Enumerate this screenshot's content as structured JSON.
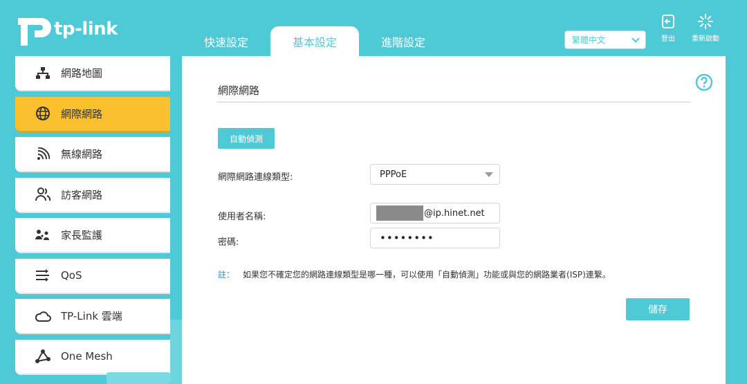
{
  "brand": {
    "logo_text": "tp-link"
  },
  "header": {
    "tabs": [
      {
        "label": "快速設定",
        "active": false
      },
      {
        "label": "基本設定",
        "active": true
      },
      {
        "label": "進階設定",
        "active": false
      }
    ],
    "language": {
      "selected": "繁體中文"
    },
    "logout_label": "登出",
    "reboot_label": "重新啟動"
  },
  "sidebar": {
    "items": [
      {
        "label": "網路地圖",
        "icon": "network-map-icon",
        "active": false
      },
      {
        "label": "網際網路",
        "icon": "globe-icon",
        "active": true
      },
      {
        "label": "無線網路",
        "icon": "wireless-icon",
        "active": false
      },
      {
        "label": "訪客網路",
        "icon": "guest-users-icon",
        "active": false
      },
      {
        "label": "家長監護",
        "icon": "parental-control-icon",
        "active": false
      },
      {
        "label": "QoS",
        "icon": "qos-icon",
        "active": false
      },
      {
        "label": "TP-Link 雲端",
        "icon": "cloud-icon",
        "active": false
      },
      {
        "label": "One Mesh",
        "icon": "mesh-icon",
        "active": false
      }
    ]
  },
  "main": {
    "title": "網際網路",
    "auto_detect_label": "自動偵測",
    "connection_type": {
      "label": "網際網路連線類型:",
      "value": "PPPoE"
    },
    "username": {
      "label": "使用者名稱:",
      "value": "@ip.hinet.net"
    },
    "password": {
      "label": "密碼:",
      "value": "••••••••"
    },
    "note": {
      "prefix": "註：",
      "text": "如果您不確定您的網路連線類型是哪一種，可以使用「自動偵測」功能或與您的網路業者(ISP)連繫。"
    },
    "save_label": "儲存"
  },
  "colors": {
    "accent": "#4ecad6",
    "active_item": "#fbc02d",
    "note_prefix": "#2a8fc1"
  }
}
